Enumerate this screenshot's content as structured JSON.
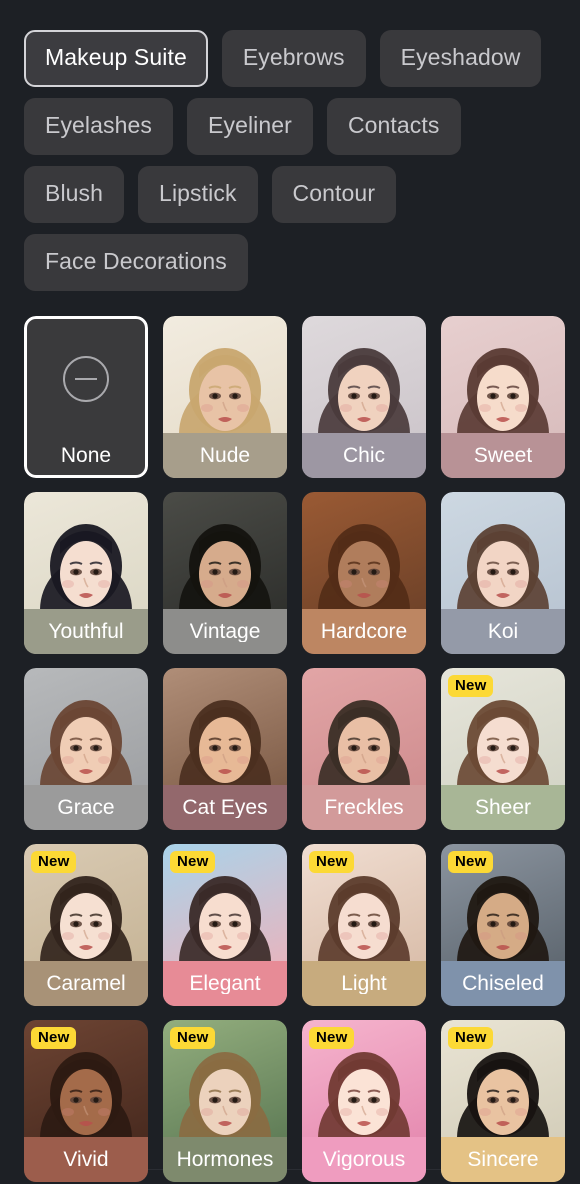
{
  "categories": {
    "rows": [
      [
        {
          "label": "Makeup Suite",
          "selected": true
        },
        {
          "label": "Eyebrows",
          "selected": false
        },
        {
          "label": "Eyeshadow",
          "selected": false
        }
      ],
      [
        {
          "label": "Eyelashes",
          "selected": false
        },
        {
          "label": "Eyeliner",
          "selected": false
        },
        {
          "label": "Contacts",
          "selected": false
        }
      ],
      [
        {
          "label": "Blush",
          "selected": false
        },
        {
          "label": "Lipstick",
          "selected": false
        },
        {
          "label": "Contour",
          "selected": false
        }
      ],
      [
        {
          "label": "Face Decorations",
          "selected": false
        }
      ]
    ]
  },
  "badge_label": "New",
  "colors": {
    "page_background": "#1d2025",
    "pill_background": "#39393c",
    "pill_selected_border": "#d4d4d8",
    "badge_background": "#fcd935",
    "badge_text": "#000000",
    "selection_ring": "#ffffff",
    "label_text": "#ffffff"
  },
  "presets": [
    {
      "name": "None",
      "icon": "minus-circle-icon",
      "selected": true,
      "new": false,
      "band": "rgba(40,40,42,0.0)",
      "bg1": "#3a3a3c",
      "bg2": "#3a3a3c",
      "skin": "#00000000",
      "hair": "#00000000"
    },
    {
      "name": "Nude",
      "selected": false,
      "new": false,
      "band": "#a79e8b",
      "bg1": "#f2ece0",
      "bg2": "#e6dcc9",
      "skin": "#e8c3a6",
      "hair": "#c8a66f"
    },
    {
      "name": "Chic",
      "selected": false,
      "new": false,
      "band": "#9d97a3",
      "bg1": "#ded9dc",
      "bg2": "#cdc6cb",
      "skin": "#f0d2bf",
      "hair": "#4a3b3c"
    },
    {
      "name": "Sweet",
      "selected": false,
      "new": false,
      "band": "#b89296",
      "bg1": "#e7cfcf",
      "bg2": "#d9bdbd",
      "skin": "#f6dccb",
      "hair": "#5a3b34"
    },
    {
      "name": "Youthful",
      "selected": false,
      "new": false,
      "band": "#9a9c8a",
      "bg1": "#ece7d9",
      "bg2": "#dcd8c6",
      "skin": "#f5ded0",
      "hair": "#191822"
    },
    {
      "name": "Vintage",
      "selected": false,
      "new": false,
      "band": "#8d8d8b",
      "bg1": "#4b4c47",
      "bg2": "#2e2f2c",
      "skin": "#d6ab8c",
      "hair": "#14130f"
    },
    {
      "name": "Hardcore",
      "selected": false,
      "new": false,
      "band": "#bd8662",
      "bg1": "#9a5a34",
      "bg2": "#6d4128",
      "skin": "#b07d5c",
      "hair": "#532c17"
    },
    {
      "name": "Koi",
      "selected": false,
      "new": false,
      "band": "#949aa8",
      "bg1": "#cdd8e2",
      "bg2": "#b9c5d2",
      "skin": "#f2d5c5",
      "hair": "#5c4134"
    },
    {
      "name": "Grace",
      "selected": false,
      "new": false,
      "band": "#9b9b9b",
      "bg1": "#b7b9bb",
      "bg2": "#9ea0a3",
      "skin": "#f0cdb5",
      "hair": "#6a4634"
    },
    {
      "name": "Cat Eyes",
      "selected": false,
      "new": false,
      "band": "#93686c",
      "bg1": "#b08e78",
      "bg2": "#7d5b46",
      "skin": "#e7b996",
      "hair": "#4b2f20"
    },
    {
      "name": "Freckles",
      "selected": false,
      "new": false,
      "band": "#d29a9a",
      "bg1": "#e2a5a6",
      "bg2": "#cf8d8f",
      "skin": "#e9bfa5",
      "hair": "#3b2e26"
    },
    {
      "name": "Sheer",
      "selected": false,
      "new": true,
      "band": "#a8b696",
      "bg1": "#e6e5da",
      "bg2": "#d3d4c6",
      "skin": "#f5ddd0",
      "hair": "#6b4a35"
    },
    {
      "name": "Caramel",
      "selected": false,
      "new": true,
      "band": "#a89277",
      "bg1": "#d9cab3",
      "bg2": "#c6b496",
      "skin": "#f6e0d2",
      "hair": "#32241c"
    },
    {
      "name": "Elegant",
      "selected": false,
      "new": true,
      "band": "#e78b96",
      "bg1": "#a9d3ea",
      "bg2": "#e9b4bd",
      "skin": "#f7ddcf",
      "hair": "#3a2a28"
    },
    {
      "name": "Light",
      "selected": false,
      "new": true,
      "band": "#c7ab7e",
      "bg1": "#f0ddd1",
      "bg2": "#d9bda9",
      "skin": "#f6ddd0",
      "hair": "#5c3c2c"
    },
    {
      "name": "Chiseled",
      "selected": false,
      "new": true,
      "band": "#7f92ab",
      "bg1": "#8b949f",
      "bg2": "#5d666f",
      "skin": "#d5ab86",
      "hair": "#201812"
    },
    {
      "name": "Vivid",
      "selected": false,
      "new": true,
      "band": "#9c5d4c",
      "bg1": "#6d4433",
      "bg2": "#47291e",
      "skin": "#a46b4a",
      "hair": "#2d1a12"
    },
    {
      "name": "Hormones",
      "selected": false,
      "new": true,
      "band": "#7e8a6d",
      "bg1": "#93ae7e",
      "bg2": "#5d7a55",
      "skin": "#ecd2bd",
      "hair": "#8a6b42"
    },
    {
      "name": "Vigorous",
      "selected": false,
      "new": true,
      "band": "#ef9cbf",
      "bg1": "#f5b4cd",
      "bg2": "#e58ab0",
      "skin": "#fbe3d6",
      "hair": "#713a33"
    },
    {
      "name": "Sincere",
      "selected": false,
      "new": true,
      "band": "#e4c285",
      "bg1": "#e9e4d4",
      "bg2": "#d3cdb9",
      "skin": "#e9c3a1",
      "hair": "#171311"
    }
  ]
}
